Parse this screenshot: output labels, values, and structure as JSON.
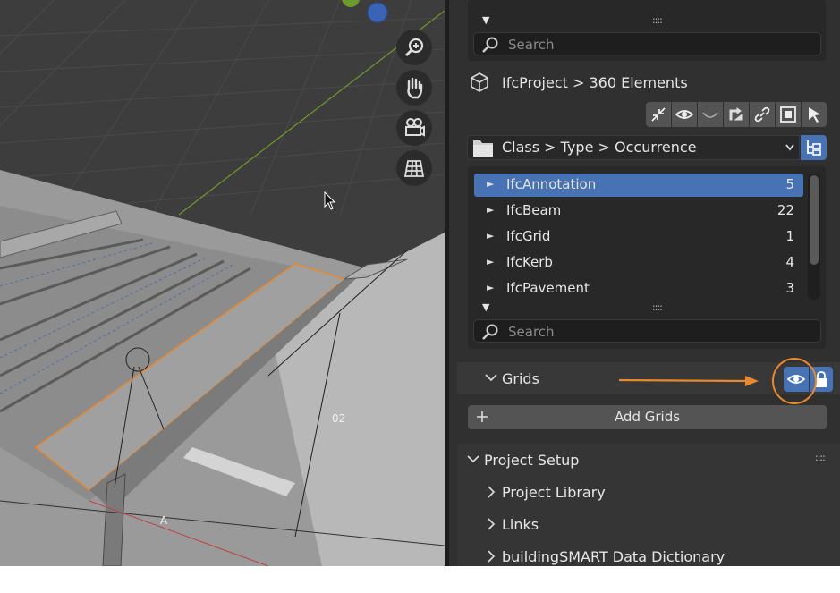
{
  "viewport": {
    "labels": {
      "grid_02": "02",
      "grid_a": "A"
    },
    "nav_tools": [
      {
        "name": "zoom-icon"
      },
      {
        "name": "hand-pan-icon"
      },
      {
        "name": "camera-view-icon"
      },
      {
        "name": "grid-view-icon"
      }
    ]
  },
  "panel": {
    "top_search": {
      "placeholder": "Search"
    },
    "project_line": "IfcProject > 360 Elements",
    "tool_icons": [
      "collapse-icon",
      "eye-icon",
      "curve-icon",
      "loop-icon",
      "link-icon",
      "select-box-icon",
      "cursor-icon"
    ],
    "grouping": {
      "selected": "Class > Type > Occurrence"
    },
    "classes": [
      {
        "name": "IfcAnnotation",
        "count": "5",
        "selected": true
      },
      {
        "name": "IfcBeam",
        "count": "22",
        "selected": false
      },
      {
        "name": "IfcGrid",
        "count": "1",
        "selected": false
      },
      {
        "name": "IfcKerb",
        "count": "4",
        "selected": false
      },
      {
        "name": "IfcPavement",
        "count": "3",
        "selected": false
      }
    ],
    "list_search": {
      "placeholder": "Search"
    },
    "grids": {
      "title": "Grids",
      "add_label": "Add Grids"
    },
    "project_setup": {
      "title": "Project Setup",
      "items": [
        "Project Library",
        "Links",
        "buildingSMART Data Dictionary"
      ]
    }
  },
  "colors": {
    "selection": "#4772b3",
    "highlight_ring": "#e8892f",
    "axis_green": "#6f9a2c"
  }
}
